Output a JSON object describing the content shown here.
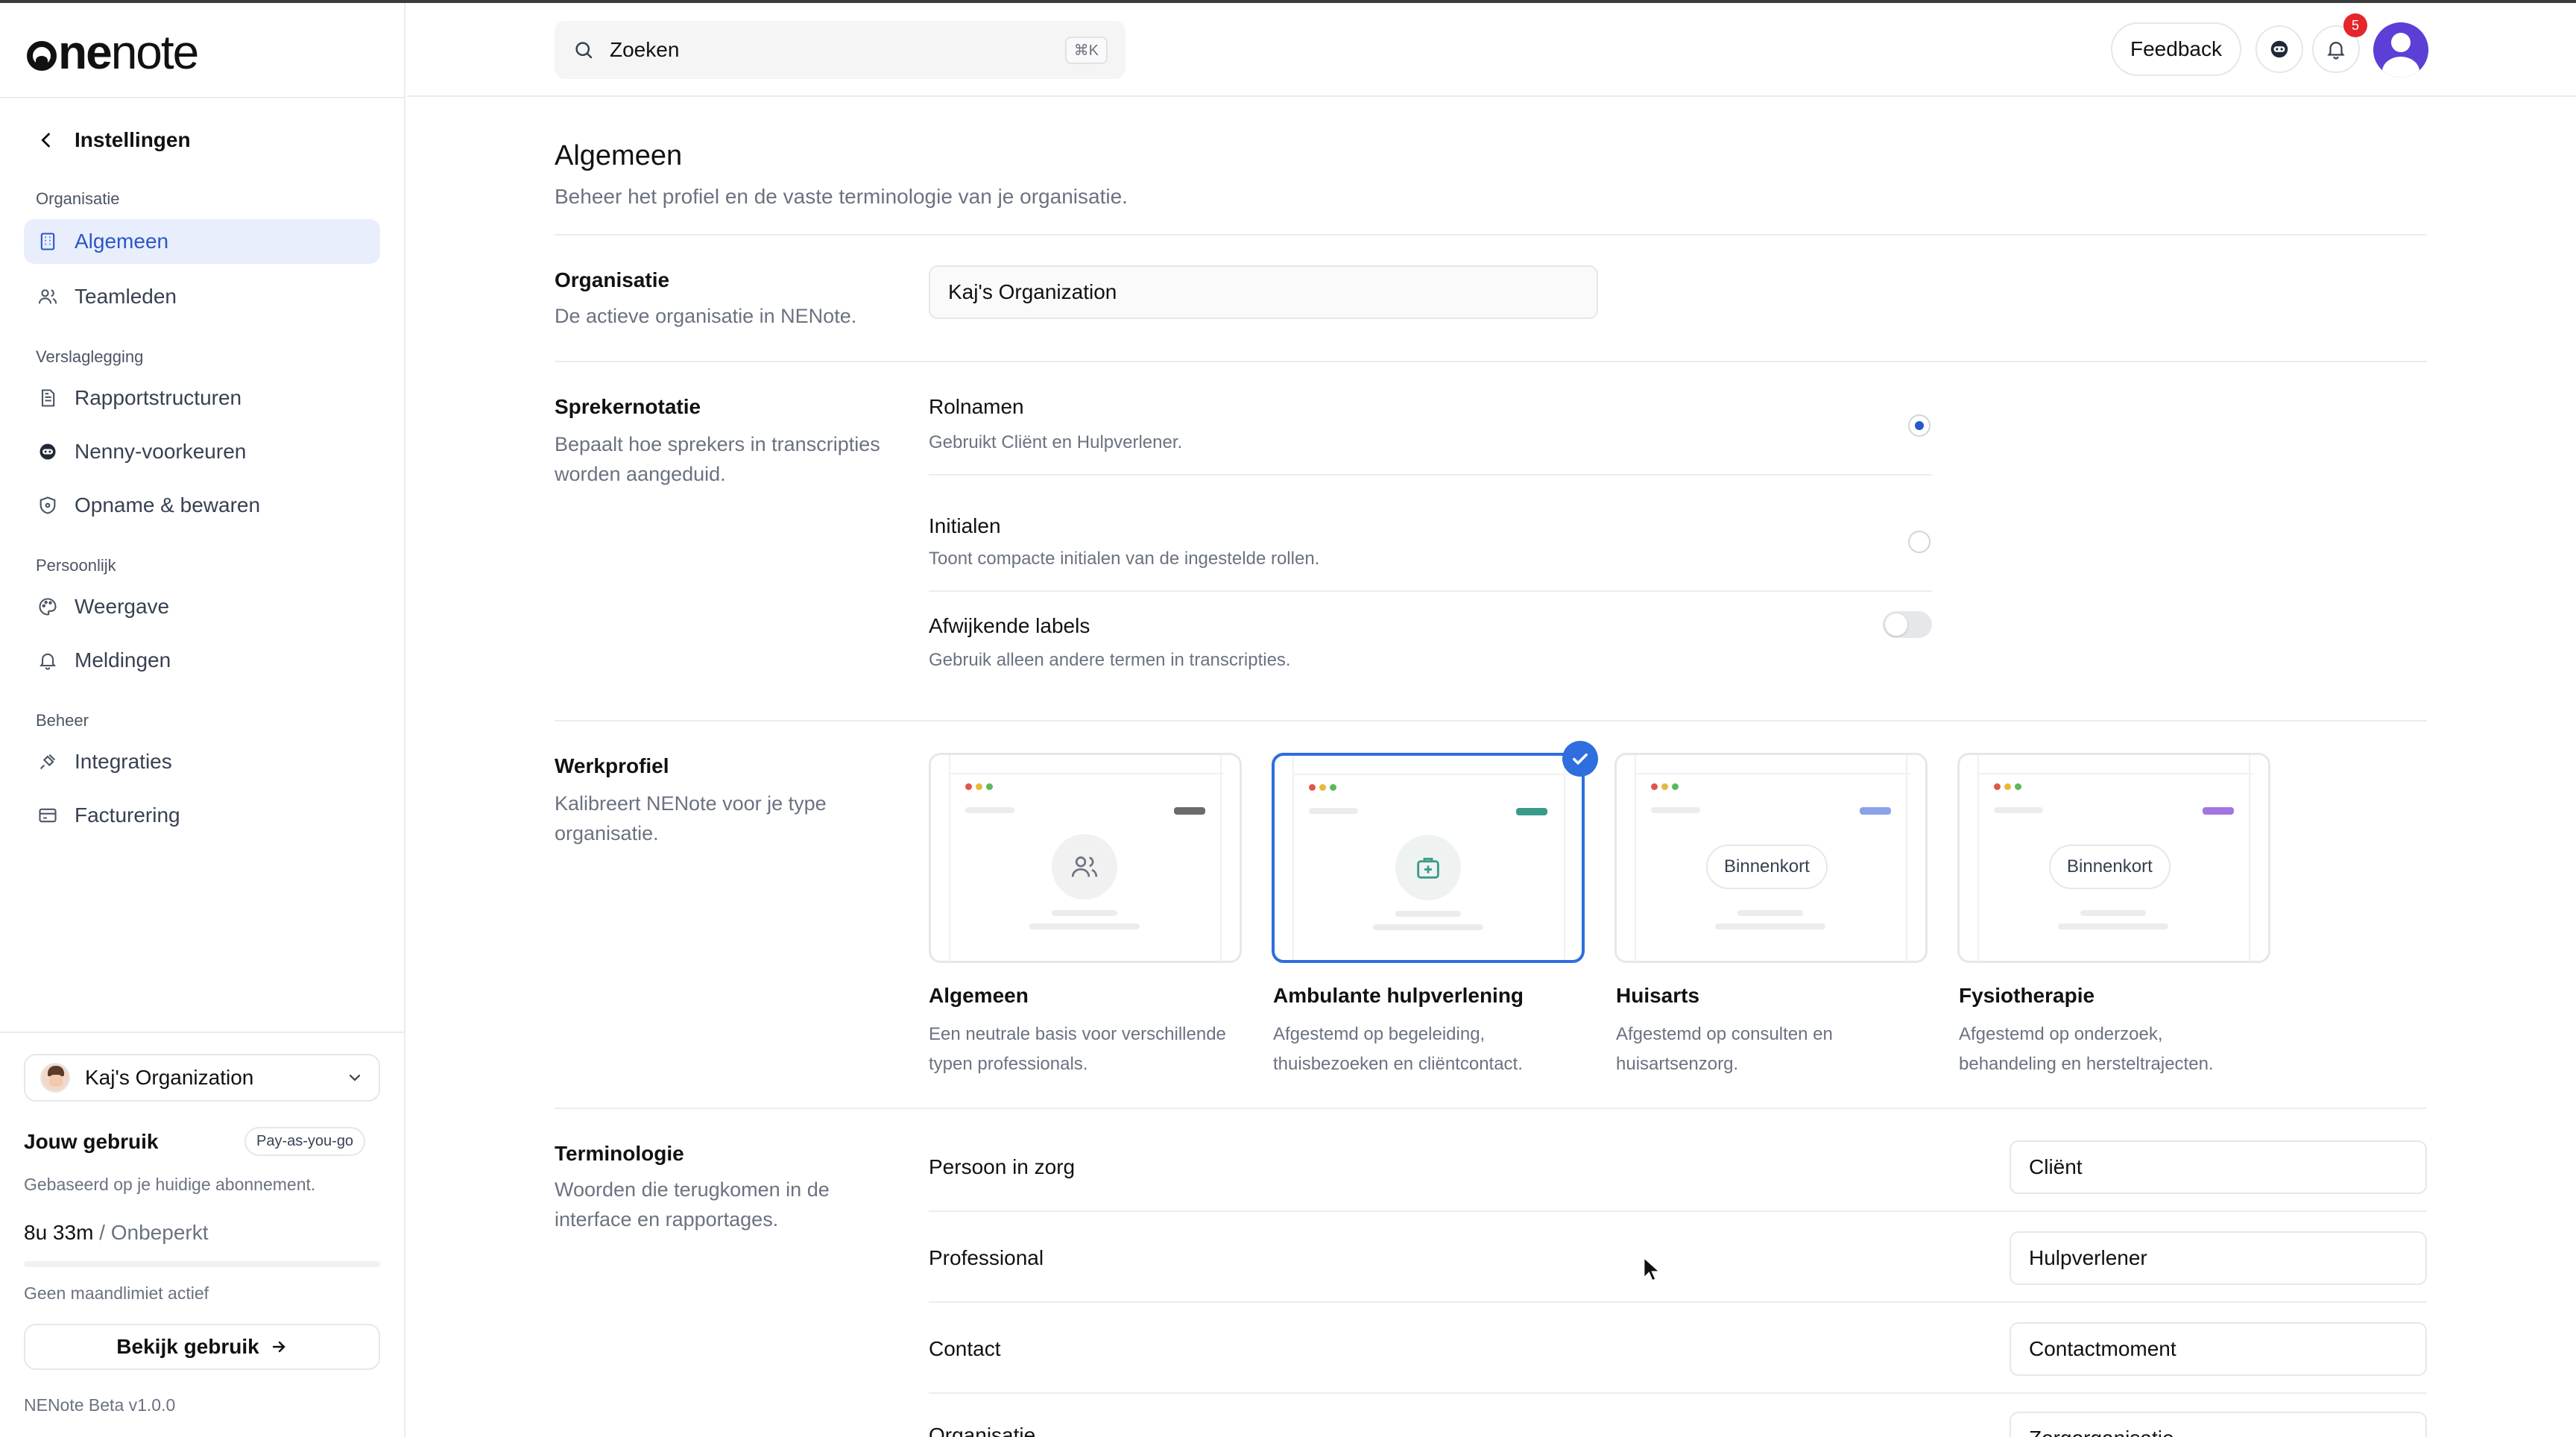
{
  "brand": {
    "logo_bold": "ne",
    "logo_rest": "note"
  },
  "sidebar": {
    "back_label": "Instellingen",
    "sections": [
      {
        "label": "Organisatie",
        "items": [
          {
            "label": "Algemeen",
            "icon": "building-icon",
            "active": true
          },
          {
            "label": "Teamleden",
            "icon": "users-icon"
          }
        ]
      },
      {
        "label": "Verslaglegging",
        "items": [
          {
            "label": "Rapportstructuren",
            "icon": "document-icon"
          },
          {
            "label": "Nenny-voorkeuren",
            "icon": "nenny-icon"
          },
          {
            "label": "Opname & bewaren",
            "icon": "shield-icon"
          }
        ]
      },
      {
        "label": "Persoonlijk",
        "items": [
          {
            "label": "Weergave",
            "icon": "palette-icon"
          },
          {
            "label": "Meldingen",
            "icon": "bell-icon"
          }
        ]
      },
      {
        "label": "Beheer",
        "items": [
          {
            "label": "Integraties",
            "icon": "plug-icon"
          },
          {
            "label": "Facturering",
            "icon": "card-icon"
          }
        ]
      }
    ],
    "org_name": "Kaj's Organization",
    "usage_title": "Jouw gebruik",
    "plan_pill": "Pay-as-you-go",
    "usage_sub": "Gebaseerd op je huidige abonnement.",
    "usage_value": "8u 33m",
    "usage_separator": " / ",
    "usage_limit_value": "Onbeperkt",
    "usage_limit_note": "Geen maandlimiet actief",
    "view_usage_label": "Bekijk gebruik",
    "version": "NENote Beta v1.0.0"
  },
  "header": {
    "search_placeholder": "Zoeken",
    "search_shortcut": "⌘K",
    "feedback_label": "Feedback",
    "notification_count": "5"
  },
  "main": {
    "title": "Algemeen",
    "subtitle": "Beheer het profiel en de vaste terminologie van je organisatie.",
    "organisation": {
      "title": "Organisatie",
      "desc": "De actieve organisatie in NENote.",
      "value": "Kaj's Organization"
    },
    "speaker": {
      "title": "Sprekernotatie",
      "desc": "Bepaalt hoe sprekers in transcripties worden aangeduid.",
      "options": [
        {
          "title": "Rolnamen",
          "desc": "Gebruikt Cliënt en Hulpverlener.",
          "selected": true
        },
        {
          "title": "Initialen",
          "desc": "Toont compacte initialen van de ingestelde rollen.",
          "selected": false
        }
      ],
      "custom_labels": {
        "title": "Afwijkende labels",
        "desc": "Gebruik alleen andere termen in transcripties.",
        "enabled": false
      }
    },
    "workprofile": {
      "title": "Werkprofiel",
      "desc": "Kalibreert NENote voor je type organisatie.",
      "cards": [
        {
          "title": "Algemeen",
          "desc": "Een neutrale basis voor verschillende typen professionals.",
          "accent": "#6b6b6b",
          "icon": "users-icon",
          "selected": false
        },
        {
          "title": "Ambulante hulpverlening",
          "desc": "Afgestemd op begeleiding, thuisbezoeken en cliëntcontact.",
          "accent": "#3a9a8a",
          "icon": "medical-bag-icon",
          "selected": true
        },
        {
          "title": "Huisarts",
          "desc": "Afgestemd op consulten en huisartsenzorg.",
          "accent": "#8aa2e8",
          "badge": "Binnenkort",
          "selected": false
        },
        {
          "title": "Fysiotherapie",
          "desc": "Afgestemd op onderzoek, behandeling en hersteltrajecten.",
          "accent": "#a276e0",
          "badge": "Binnenkort",
          "selected": false
        }
      ]
    },
    "terminology": {
      "title": "Terminologie",
      "desc": "Woorden die terugkomen in de interface en rapportages.",
      "rows": [
        {
          "label": "Persoon in zorg",
          "value": "Cliënt"
        },
        {
          "label": "Professional",
          "value": "Hulpverlener"
        },
        {
          "label": "Contact",
          "value": "Contactmoment"
        },
        {
          "label": "Organisatie",
          "value": "Zorgorganisatie"
        }
      ]
    }
  }
}
